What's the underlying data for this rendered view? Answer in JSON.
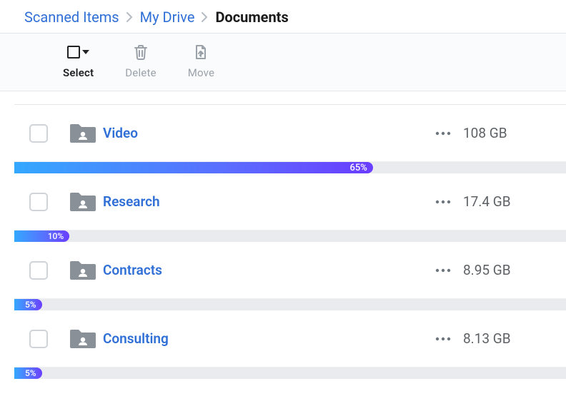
{
  "breadcrumb": {
    "items": [
      {
        "label": "Scanned Items"
      },
      {
        "label": "My Drive"
      }
    ],
    "current": "Documents"
  },
  "toolbar": {
    "select_label": "Select",
    "delete_label": "Delete",
    "move_label": "Move"
  },
  "rows": [
    {
      "name": "Video",
      "size": "108 GB",
      "percent": 65,
      "percent_label": "65%"
    },
    {
      "name": "Research",
      "size": "17.4 GB",
      "percent": 10,
      "percent_label": "10%"
    },
    {
      "name": "Contracts",
      "size": "8.95 GB",
      "percent": 5,
      "percent_label": "5%"
    },
    {
      "name": "Consulting",
      "size": "8.13 GB",
      "percent": 5,
      "percent_label": "5%"
    }
  ],
  "colors": {
    "link": "#2f6fd6",
    "muted": "#9aa1a9",
    "progress_from": "#34a8ff",
    "progress_to": "#6a3dff"
  }
}
